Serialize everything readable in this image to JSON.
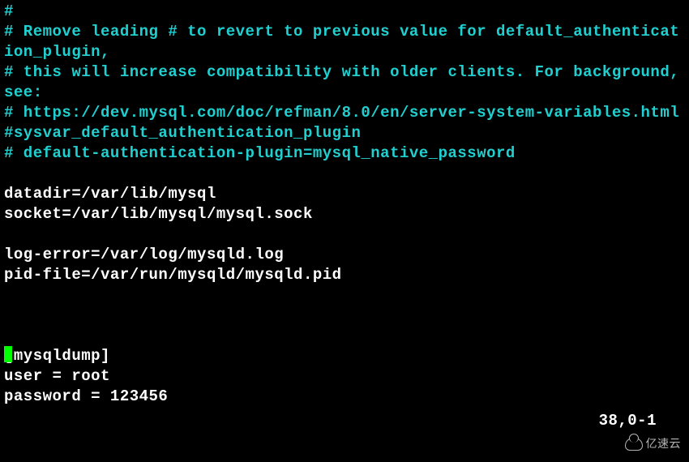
{
  "terminal": {
    "lines": [
      {
        "cls": "comment",
        "text": "#"
      },
      {
        "cls": "comment",
        "text": "# Remove leading # to revert to previous value for default_authentication_plugin,"
      },
      {
        "cls": "comment",
        "text": "# this will increase compatibility with older clients. For background, see:"
      },
      {
        "cls": "comment",
        "text": "# https://dev.mysql.com/doc/refman/8.0/en/server-system-variables.html#sysvar_default_authentication_plugin"
      },
      {
        "cls": "comment",
        "text": "# default-authentication-plugin=mysql_native_password"
      },
      {
        "cls": "blank",
        "text": ""
      },
      {
        "cls": "plain",
        "text": "datadir=/var/lib/mysql"
      },
      {
        "cls": "plain",
        "text": "socket=/var/lib/mysql/mysql.sock"
      },
      {
        "cls": "blank",
        "text": ""
      },
      {
        "cls": "plain",
        "text": "log-error=/var/log/mysqld.log"
      },
      {
        "cls": "plain",
        "text": "pid-file=/var/run/mysqld/mysqld.pid"
      },
      {
        "cls": "blank",
        "text": ""
      },
      {
        "cls": "blank",
        "text": ""
      },
      {
        "cls": "blank",
        "text": ""
      },
      {
        "cls": "plain",
        "text": "[mysqldump]"
      },
      {
        "cls": "plain",
        "text": "user = root"
      },
      {
        "cls": "plain",
        "text": "password = 123456"
      }
    ],
    "status_position": "38,0-1",
    "watermark_text": "亿速云"
  }
}
